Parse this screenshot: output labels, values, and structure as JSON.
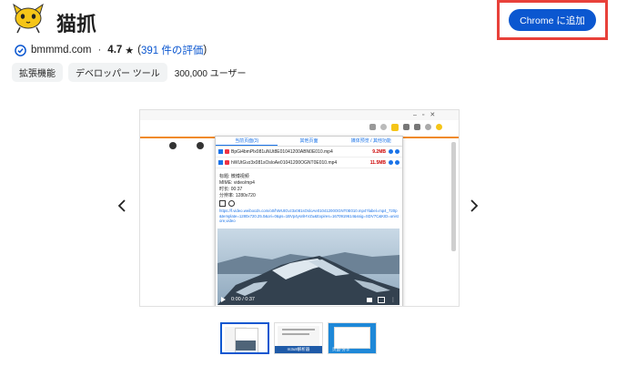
{
  "extension": {
    "name": "猫抓",
    "website": "bmmmd.com",
    "rating": "4.7",
    "star": "★",
    "reviews_link": "391 件の評価",
    "add_button": "Chrome に追加",
    "chips": [
      "拡張機能",
      "デベロッパー ツール"
    ],
    "users": "300,000 ユーザー",
    "accent": "#0b57d0",
    "highlight": "#e8413a"
  },
  "carousel": {
    "prev": "‹",
    "next": "›",
    "popup": {
      "tabs": [
        "当前页面(3)",
        "其他页面",
        "媒体预览 / 其他功能"
      ],
      "files": [
        {
          "name": "BpGi4bmPlx081uNUt8E01041200ABN0E010.mp4",
          "size": "9.2MB"
        },
        {
          "name": "hWUtGvz3x081sOsloAe01041200OGNT0E010.mp4",
          "size": "11.5MB"
        }
      ],
      "detail_lines": [
        "标题: 微博视频",
        "MIME: video/mp4",
        "时长: 00:37",
        "分辨率: 1280x720"
      ],
      "url_text": "https://f.video.weibocdn.com/o0/hWUtGvz3x081sOsloAe01041200OGNT0E010.mp4?label=mp4_720p&template=1280x720.25.0&ori=0&ps=1BVp4ysnlHVZu&Expires=1670919614&ssig=SDV7C&KID=unistore,video",
      "time": "0:00 / 0:37"
    },
    "thumb2_label": "m3u8解析器",
    "thumb3_label": "页面-分享"
  }
}
